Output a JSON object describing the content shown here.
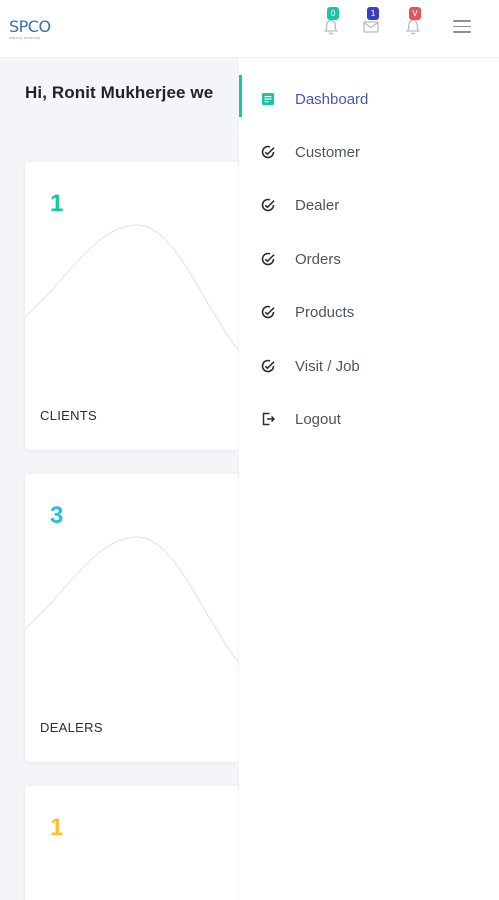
{
  "header": {
    "logo_text": "SPCO",
    "logo_subtext": "SPECIAL PURPOSE",
    "notifications": [
      {
        "icon": "bell-icon",
        "badge": "0",
        "badge_color": "#19c6a3"
      },
      {
        "icon": "mail-icon",
        "badge": "1",
        "badge_color": "#3a3fc1"
      },
      {
        "icon": "bell-icon",
        "badge": "V",
        "badge_color": "#e2545b"
      }
    ],
    "menu_icon": "hamburger-icon"
  },
  "greeting": "Hi, Ronit Mukherjee we",
  "cards": [
    {
      "value": "1",
      "label": "CLIENTS",
      "color": "#19c6a3"
    },
    {
      "value": "3",
      "label": "DEALERS",
      "color": "#1ec0e0"
    },
    {
      "value": "1",
      "label": "",
      "color": "#f4c430"
    }
  ],
  "sidebar": {
    "accent_color": "#19c6a3",
    "items": [
      {
        "label": "Dashboard",
        "icon": "dashboard-icon",
        "active": true
      },
      {
        "label": "Customer",
        "icon": "check-circle-icon"
      },
      {
        "label": "Dealer",
        "icon": "check-circle-icon"
      },
      {
        "label": "Orders",
        "icon": "check-circle-icon"
      },
      {
        "label": "Products",
        "icon": "check-circle-icon"
      },
      {
        "label": "Visit / Job",
        "icon": "check-circle-icon"
      },
      {
        "label": "Logout",
        "icon": "logout-icon"
      }
    ]
  }
}
